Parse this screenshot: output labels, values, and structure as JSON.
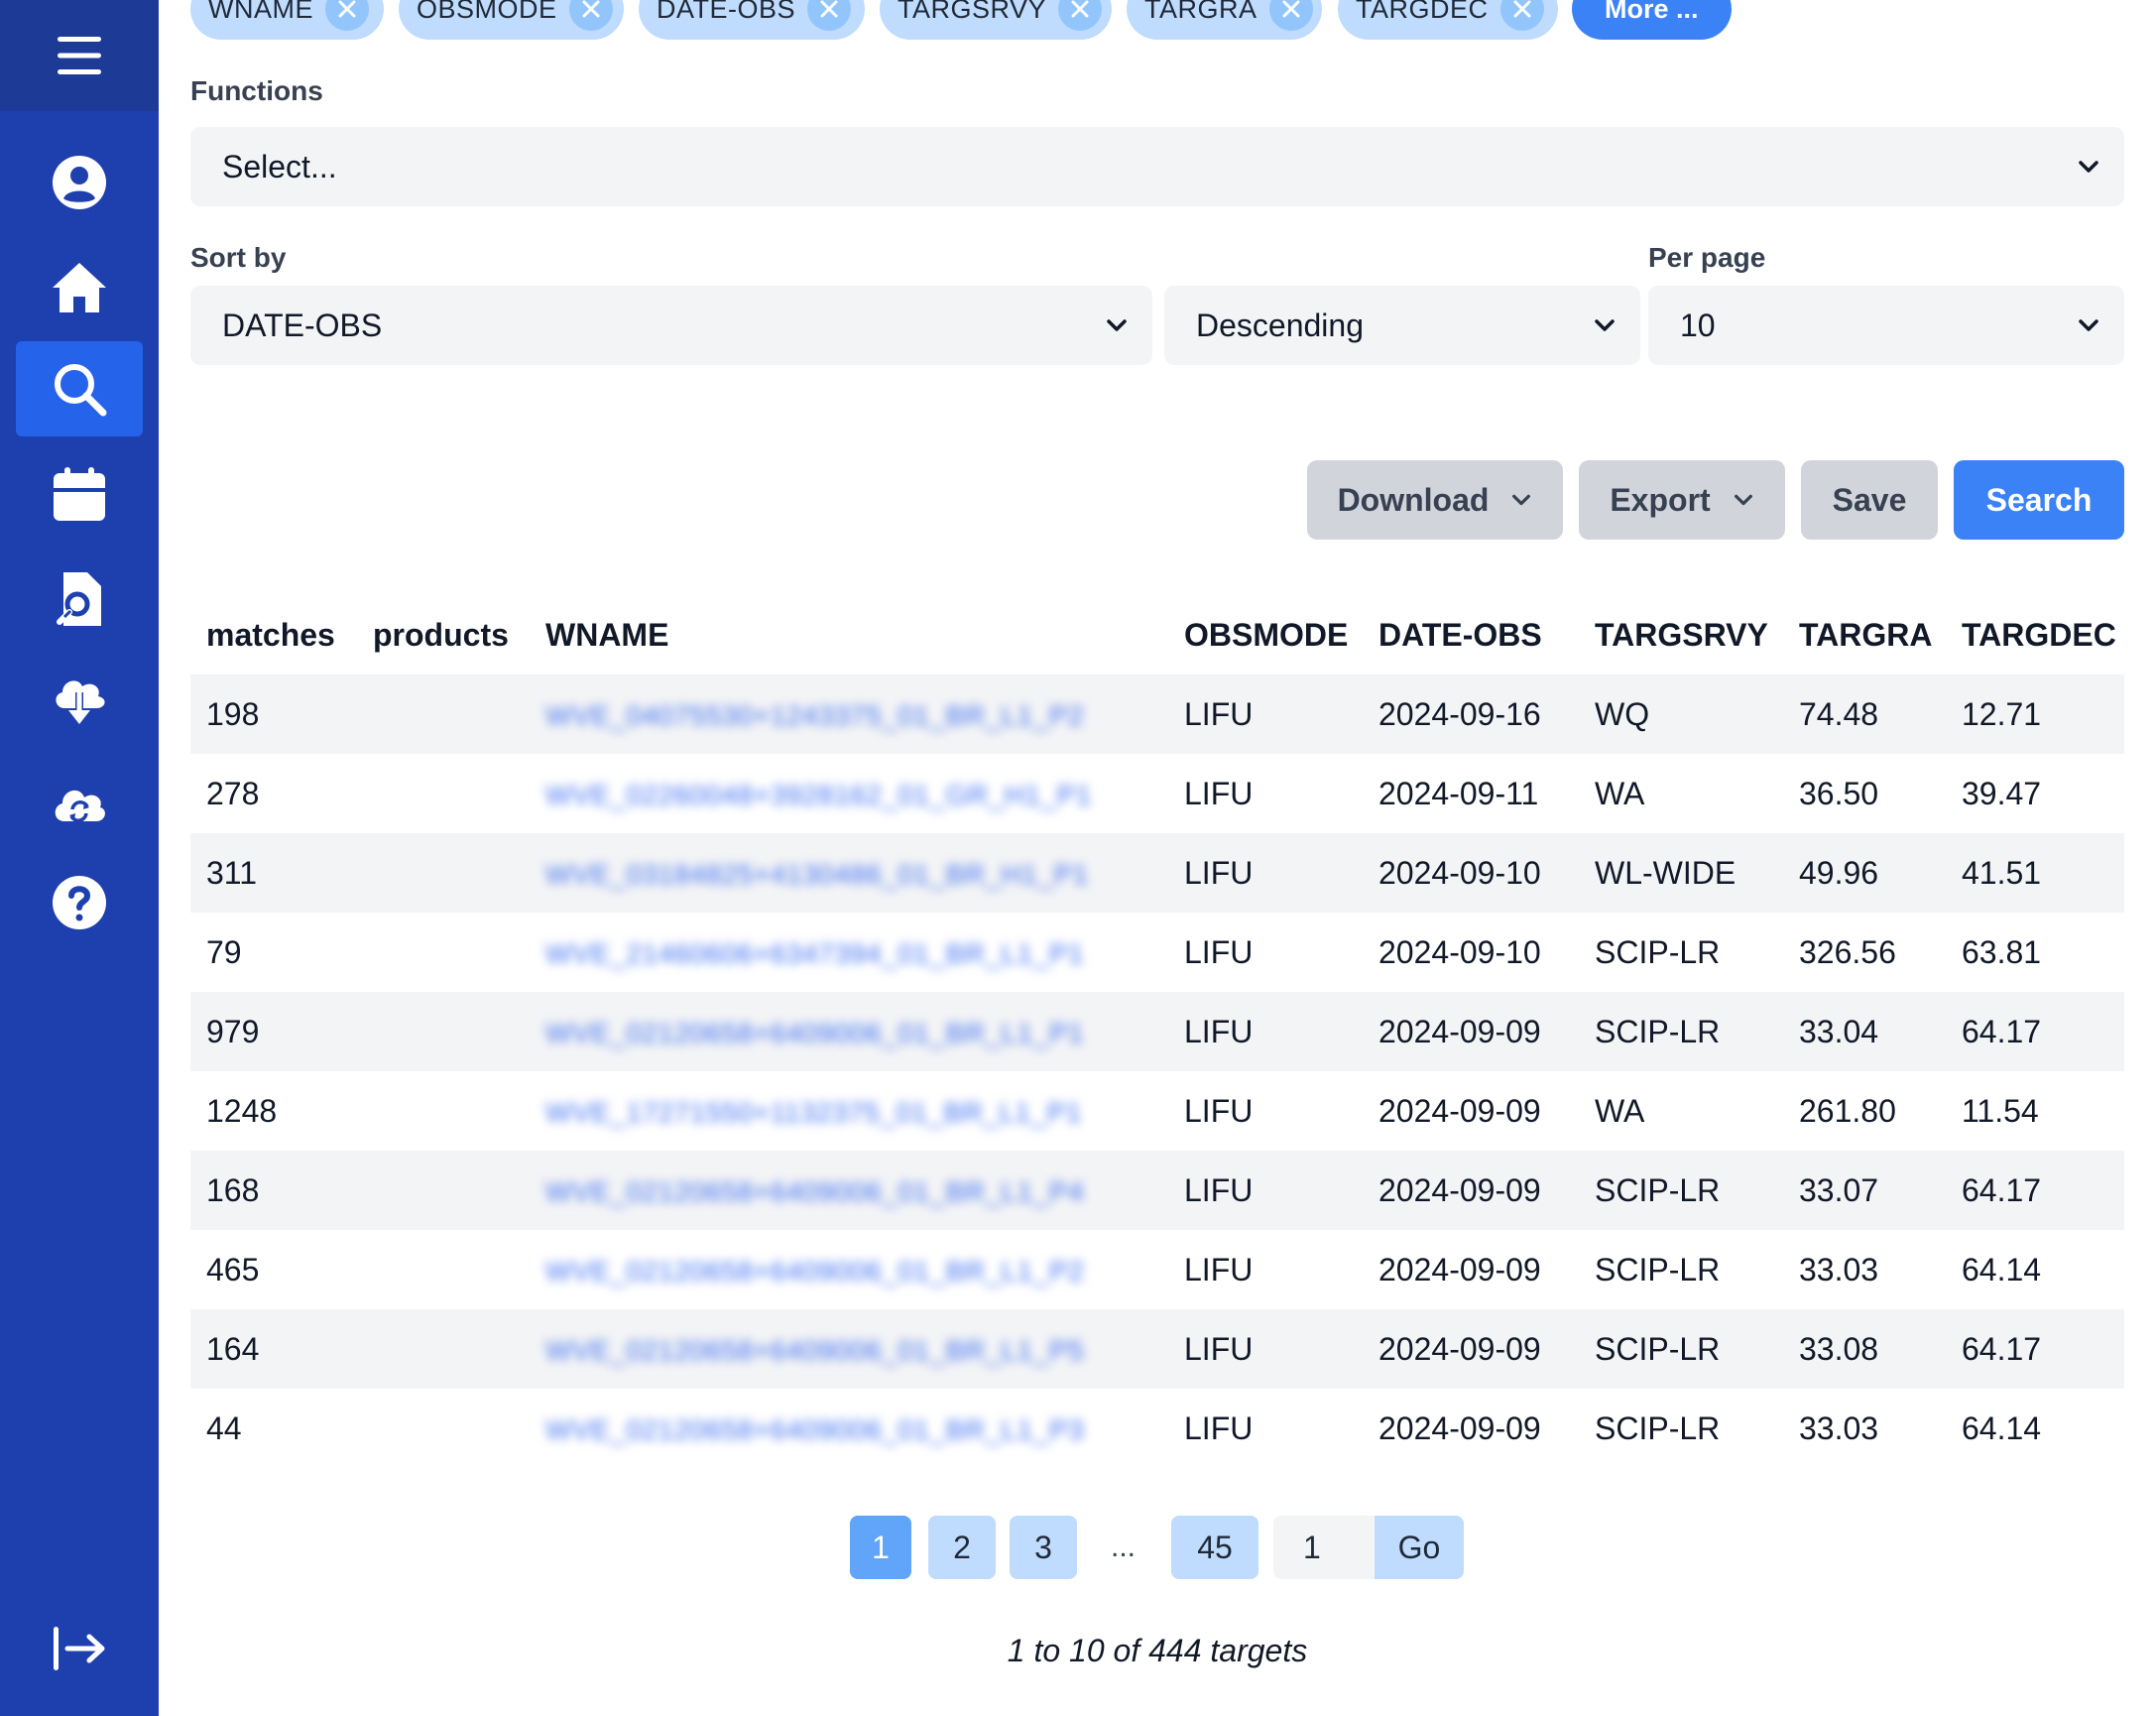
{
  "sidebar": {
    "items": [
      {
        "name": "user-icon"
      },
      {
        "name": "home-icon"
      },
      {
        "name": "search-icon",
        "active": true
      },
      {
        "name": "calendar-icon"
      },
      {
        "name": "file-search-icon"
      },
      {
        "name": "cloud-download-icon"
      },
      {
        "name": "cloud-sync-icon"
      },
      {
        "name": "help-icon"
      }
    ],
    "menu_icon": "menu-icon",
    "logout_icon": "logout-icon"
  },
  "columns_chips": [
    "WNAME",
    "OBSMODE",
    "DATE-OBS",
    "TARGSRVY",
    "TARGRA",
    "TARGDEC"
  ],
  "more_label": "More ...",
  "functions": {
    "label": "Functions",
    "placeholder": "Select..."
  },
  "sort": {
    "label": "Sort by",
    "field": "DATE-OBS",
    "order": "Descending"
  },
  "per_page": {
    "label": "Per page",
    "value": "10"
  },
  "actions": {
    "download": "Download",
    "export": "Export",
    "save": "Save",
    "search": "Search"
  },
  "table": {
    "headers": [
      "matches",
      "products",
      "WNAME",
      "OBSMODE",
      "DATE-OBS",
      "TARGSRVY",
      "TARGRA",
      "TARGDEC"
    ],
    "rows": [
      [
        "198",
        "",
        "WVE_04075530+1243375_01_BR_L1_P2",
        "LIFU",
        "2024-09-16",
        "WQ",
        "74.48",
        "12.71"
      ],
      [
        "278",
        "",
        "WVE_02260048+3928162_01_GR_H1_P1",
        "LIFU",
        "2024-09-11",
        "WA",
        "36.50",
        "39.47"
      ],
      [
        "311",
        "",
        "WVE_03184825+4130486_01_BR_H1_P1",
        "LIFU",
        "2024-09-10",
        "WL-WIDE",
        "49.96",
        "41.51"
      ],
      [
        "79",
        "",
        "WVE_21460606+6347394_01_BR_L1_P1",
        "LIFU",
        "2024-09-10",
        "SCIP-LR",
        "326.56",
        "63.81"
      ],
      [
        "979",
        "",
        "WVE_02120658+6409006_01_BR_L1_P1",
        "LIFU",
        "2024-09-09",
        "SCIP-LR",
        "33.04",
        "64.17"
      ],
      [
        "1248",
        "",
        "WVE_17271550+1132375_01_BR_L1_P1",
        "LIFU",
        "2024-09-09",
        "WA",
        "261.80",
        "11.54"
      ],
      [
        "168",
        "",
        "WVE_02120658+6409006_01_BR_L1_P4",
        "LIFU",
        "2024-09-09",
        "SCIP-LR",
        "33.07",
        "64.17"
      ],
      [
        "465",
        "",
        "WVE_02120658+6409006_01_BR_L1_P2",
        "LIFU",
        "2024-09-09",
        "SCIP-LR",
        "33.03",
        "64.14"
      ],
      [
        "164",
        "",
        "WVE_02120658+6409006_01_BR_L1_P5",
        "LIFU",
        "2024-09-09",
        "SCIP-LR",
        "33.08",
        "64.17"
      ],
      [
        "44",
        "",
        "WVE_02120658+6409006_01_BR_L1_P3",
        "LIFU",
        "2024-09-09",
        "SCIP-LR",
        "33.03",
        "64.14"
      ]
    ]
  },
  "pagination": {
    "pages": [
      "1",
      "2",
      "3"
    ],
    "ellipsis": "...",
    "last": "45",
    "current": "1",
    "goto_value": "1",
    "go_label": "Go"
  },
  "summary": "1 to 10 of 444 targets",
  "colors": {
    "sidebar": "#1e3fae",
    "sidebar_active": "#2563eb",
    "chip": "#bfdbfe",
    "primary": "#3b82f6"
  }
}
